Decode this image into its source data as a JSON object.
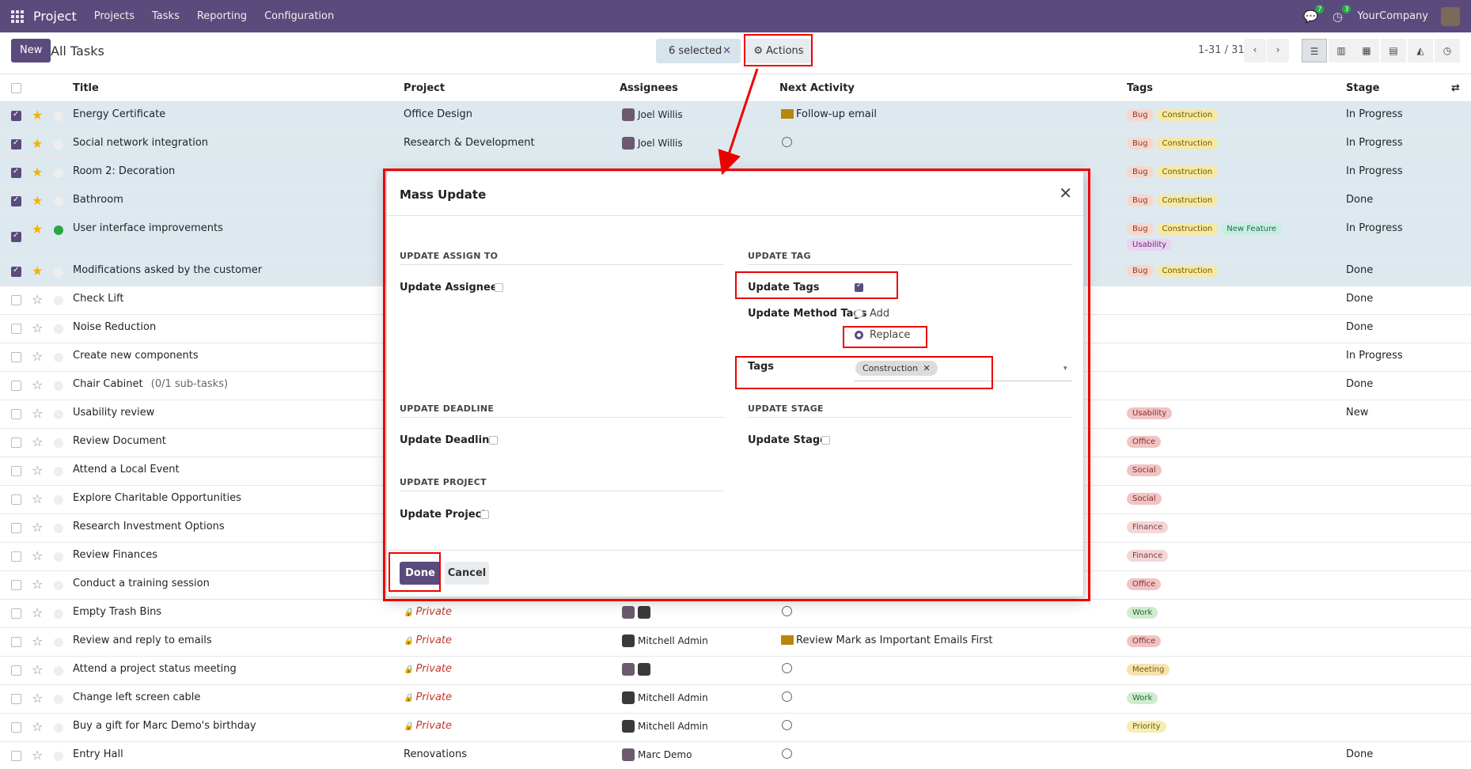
{
  "navbar": {
    "app": "Project",
    "menu": [
      "Projects",
      "Tasks",
      "Reporting",
      "Configuration"
    ],
    "messages_count": "7",
    "activities_count": "3",
    "company": "YourCompany"
  },
  "control": {
    "new_label": "New",
    "breadcrumb": "All Tasks",
    "selected": "6 selected",
    "actions": "Actions",
    "pager": "1-31 / 31"
  },
  "columns": [
    "Title",
    "Project",
    "Assignees",
    "Next Activity",
    "Tags",
    "Stage"
  ],
  "rows": [
    {
      "title": "Energy Certificate",
      "project": "Office Design",
      "assignee": "Joel Willis",
      "activity": "Follow-up email",
      "tags": [
        "Bug",
        "Construction"
      ],
      "stage": "In Progress"
    },
    {
      "title": "Social network integration",
      "project": "Research & Development",
      "assignee": "Joel Willis",
      "activity": "",
      "tags": [
        "Bug",
        "Construction"
      ],
      "stage": "In Progress"
    },
    {
      "title": "Room 2: Decoration",
      "project": "",
      "assignee": "",
      "activity": "",
      "tags": [
        "Bug",
        "Construction"
      ],
      "stage": "In Progress"
    },
    {
      "title": "Bathroom",
      "project": "",
      "assignee": "",
      "activity": "",
      "tags": [
        "Bug",
        "Construction"
      ],
      "stage": "Done"
    },
    {
      "title": "User interface improvements",
      "project": "",
      "assignee": "",
      "activity": "",
      "tags": [
        "Bug",
        "Construction",
        "New Feature",
        "Usability"
      ],
      "stage": "In Progress"
    },
    {
      "title": "Modifications asked by the customer",
      "project": "",
      "assignee": "",
      "activity": "",
      "tags": [
        "Bug",
        "Construction"
      ],
      "stage": "Done"
    },
    {
      "title": "Check Lift",
      "stage": "Done"
    },
    {
      "title": "Noise Reduction",
      "stage": "Done"
    },
    {
      "title": "Create new components",
      "stage": "In Progress"
    },
    {
      "title": "Chair Cabinet",
      "subtasks": "(0/1 sub-tasks)",
      "stage": "Done"
    },
    {
      "title": "Usability review",
      "tags": [
        "Usability"
      ],
      "stage": "New"
    },
    {
      "title": "Review Document",
      "tags": [
        "Office"
      ]
    },
    {
      "title": "Attend a Local Event",
      "tags": [
        "Social"
      ]
    },
    {
      "title": "Explore Charitable Opportunities",
      "tags": [
        "Social"
      ]
    },
    {
      "title": "Research Investment Options",
      "tags": [
        "Finance"
      ]
    },
    {
      "title": "Review Finances",
      "tags": [
        "Finance"
      ]
    },
    {
      "title": "Conduct a training session",
      "tags": [
        "Office"
      ]
    },
    {
      "title": "Empty Trash Bins",
      "project": "Private",
      "tags": [
        "Work"
      ]
    },
    {
      "title": "Review and reply to emails",
      "project": "Private",
      "assignee": "Mitchell Admin",
      "activity": "Review Mark as Important Emails First",
      "tags": [
        "Office"
      ]
    },
    {
      "title": "Attend a project status meeting",
      "project": "Private",
      "tags": [
        "Meeting"
      ]
    },
    {
      "title": "Change left screen cable",
      "project": "Private",
      "assignee": "Mitchell Admin",
      "tags": [
        "Work"
      ]
    },
    {
      "title": "Buy a gift for Marc Demo's birthday",
      "project": "Private",
      "assignee": "Mitchell Admin",
      "tags": [
        "Priority"
      ]
    },
    {
      "title": "Entry Hall",
      "project": "Renovations",
      "assignee": "Marc Demo",
      "stage": "Done"
    }
  ],
  "modal": {
    "title": "Mass Update",
    "sections": {
      "assign": "UPDATE ASSIGN TO",
      "tag": "UPDATE TAG",
      "deadline": "UPDATE DEADLINE",
      "stage": "UPDATE STAGE",
      "project": "UPDATE PROJECT"
    },
    "fields": {
      "update_assignees": "Update Assignees",
      "update_tags": "Update Tags",
      "update_method_tags": "Update Method Tags",
      "add": "Add",
      "replace": "Replace",
      "tags": "Tags",
      "tag_value": "Construction",
      "update_deadline": "Update Deadline",
      "update_stage": "Update Stage",
      "update_project": "Update Project"
    },
    "done": "Done",
    "cancel": "Cancel"
  },
  "colors": {
    "brand": "#5a4b7c",
    "annotation": "#ee0000",
    "selected_row": "#dde9ef"
  }
}
